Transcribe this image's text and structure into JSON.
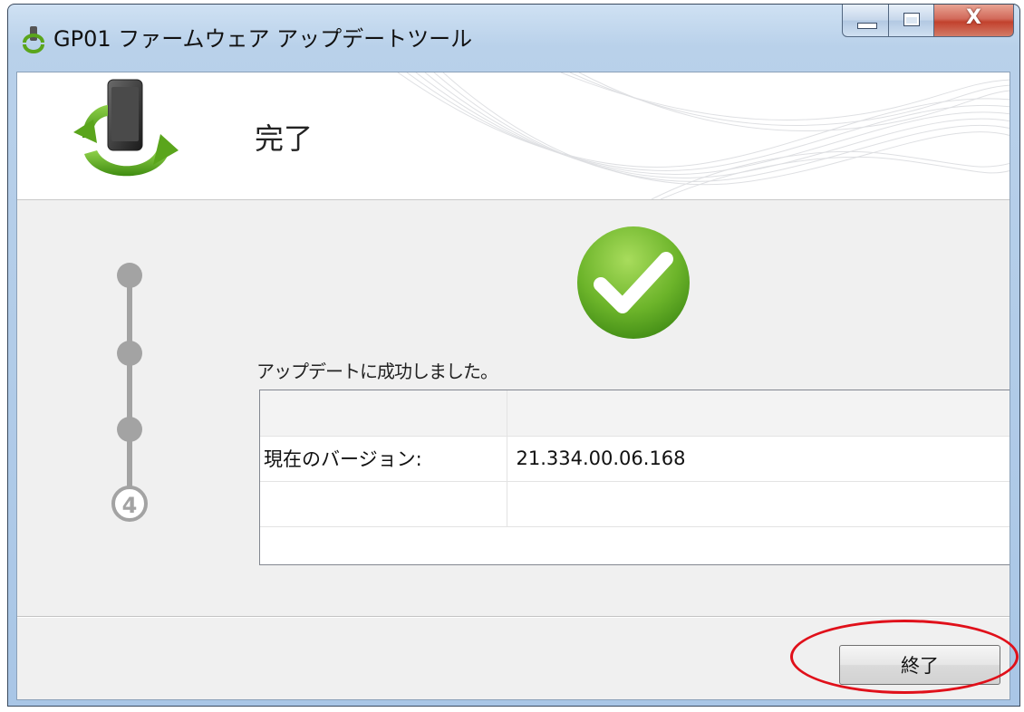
{
  "window": {
    "title": "GP01 ファームウェア アップデートツール",
    "close_glyph": "X"
  },
  "banner": {
    "page_title": "完了"
  },
  "steps": {
    "current_step": "4"
  },
  "main": {
    "success_message": "アップデートに成功しました。",
    "table": {
      "rows": [
        {
          "label": "",
          "value": ""
        },
        {
          "label": "現在のバージョン:",
          "value": "21.334.00.06.168"
        },
        {
          "label": "",
          "value": ""
        }
      ]
    }
  },
  "footer": {
    "finish_label": "終了"
  },
  "colors": {
    "accent_green": "#5aa51c",
    "annotation_red": "#e0101a"
  }
}
